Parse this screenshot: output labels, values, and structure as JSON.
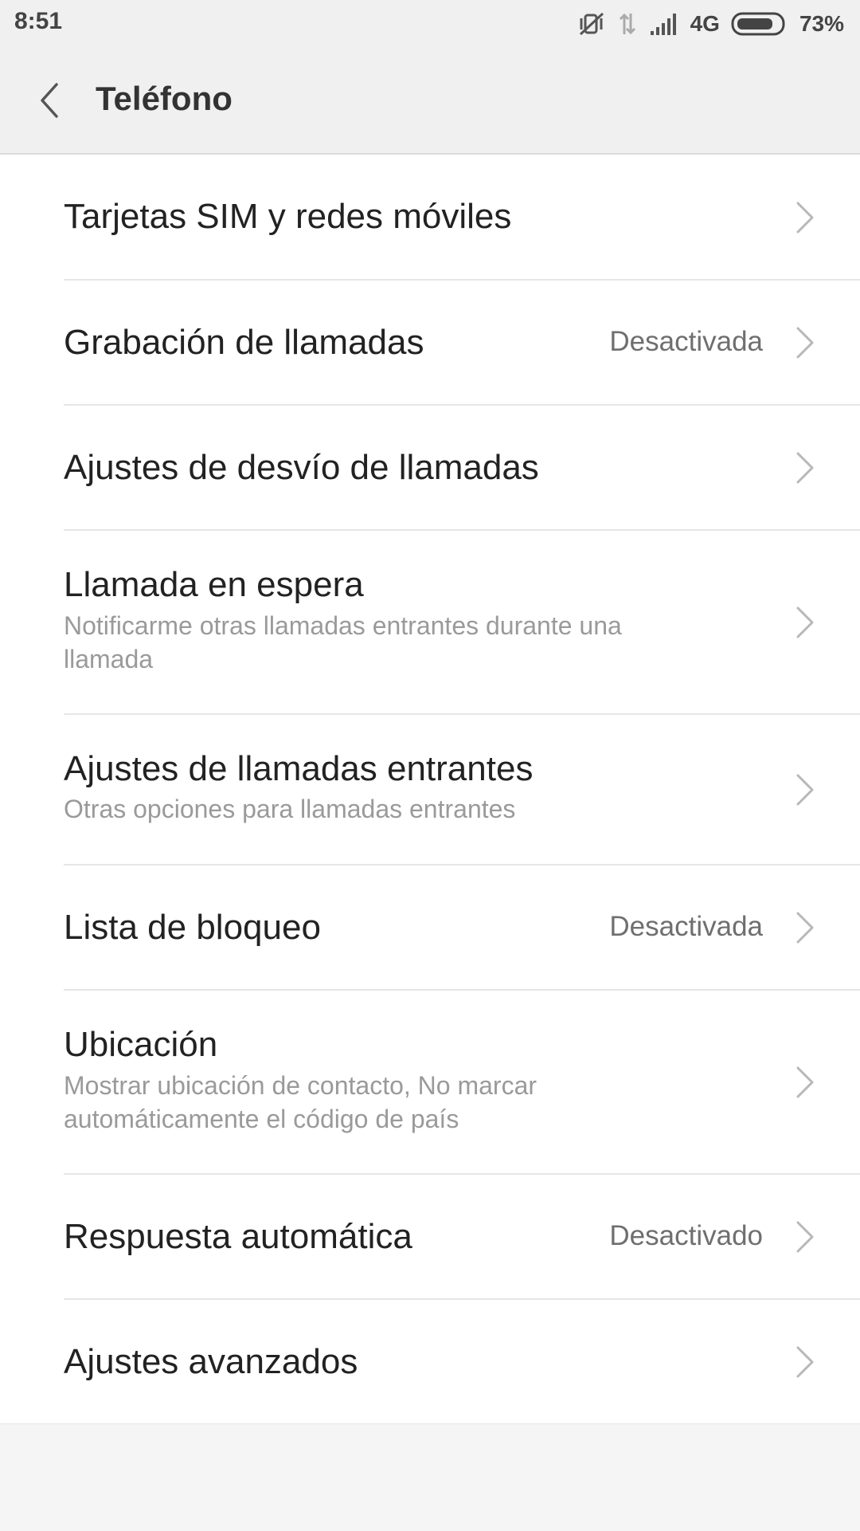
{
  "status_bar": {
    "time": "8:51",
    "network": "4G",
    "battery": "73%",
    "icons": [
      "mute-vibrate-icon",
      "data-transfer-icon",
      "signal-icon",
      "battery-icon"
    ]
  },
  "header": {
    "back_icon": "chevron-left-icon",
    "title": "Teléfono"
  },
  "settings": {
    "items": [
      {
        "title": "Tarjetas SIM y redes móviles"
      },
      {
        "title": "Grabación de llamadas",
        "value": "Desactivada"
      },
      {
        "title": "Ajustes de desvío de llamadas"
      },
      {
        "title": "Llamada en espera",
        "subtitle": "Notificarme otras llamadas entrantes durante una llamada"
      },
      {
        "title": "Ajustes de llamadas entrantes",
        "subtitle": "Otras opciones para llamadas entrantes"
      },
      {
        "title": "Lista de bloqueo",
        "value": "Desactivada"
      },
      {
        "title": "Ubicación",
        "subtitle": "Mostrar ubicación de contacto, No marcar automáticamente el código de país"
      },
      {
        "title": "Respuesta automática",
        "value": "Desactivado"
      },
      {
        "title": "Ajustes avanzados"
      }
    ]
  },
  "colors": {
    "header_bg": "#f0f0f0",
    "list_bg": "#ffffff",
    "title_text": "#222222",
    "subtitle_text": "#9a9a9a",
    "value_text": "#6f6f6f",
    "chevron": "#b8b8b8"
  }
}
